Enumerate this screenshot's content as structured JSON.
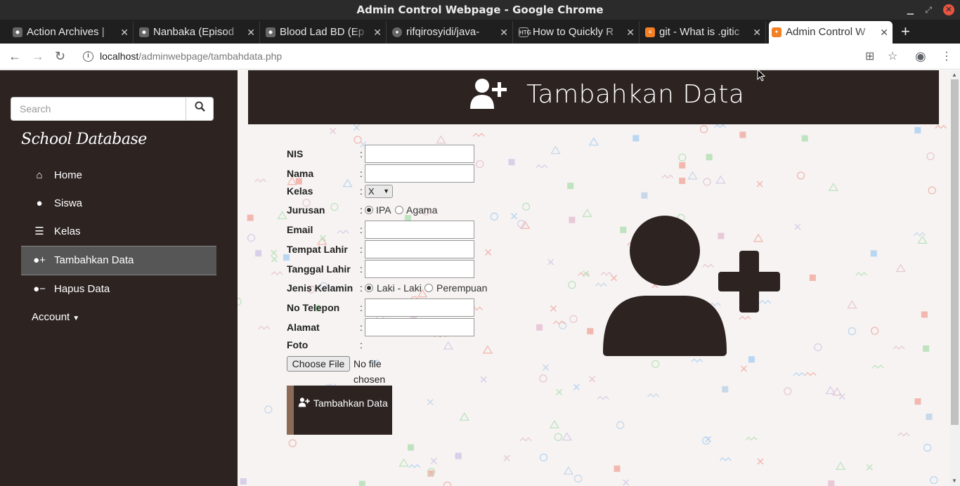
{
  "window": {
    "title": "Admin Control Webpage - Google Chrome"
  },
  "tabs": [
    {
      "label": "Action Archives |",
      "favicon": "cat-icon"
    },
    {
      "label": "Nanbaka (Episod",
      "favicon": "cat-icon"
    },
    {
      "label": "Blood Lad BD (Ep",
      "favicon": "cat-icon"
    },
    {
      "label": "rifqirosyidi/java-",
      "favicon": "github-icon"
    },
    {
      "label": "How to Quickly R",
      "favicon": "htg-icon"
    },
    {
      "label": "git - What is .gitic",
      "favicon": "stackoverflow-icon"
    },
    {
      "label": "Admin Control W",
      "favicon": "page-icon",
      "active": true
    }
  ],
  "address": {
    "host": "localhost",
    "path": "/adminwebpage/tambahdata.php"
  },
  "sidebar": {
    "search_placeholder": "Search",
    "brand": "School Database",
    "items": [
      {
        "label": "Home",
        "icon": "home-icon"
      },
      {
        "label": "Siswa",
        "icon": "user-icon"
      },
      {
        "label": "Kelas",
        "icon": "list-icon"
      },
      {
        "label": "Tambahkan Data",
        "icon": "user-plus-icon",
        "active": true
      },
      {
        "label": "Hapus Data",
        "icon": "user-minus-icon"
      }
    ],
    "account": "Account"
  },
  "header": {
    "title": "Tambahkan Data"
  },
  "form": {
    "nis": "NIS",
    "nama": "Nama",
    "kelas": "Kelas",
    "kelas_value": "X",
    "jurusan": "Jurusan",
    "jurusan_opt1": "IPA",
    "jurusan_opt2": "Agama",
    "email": "Email",
    "tempat_lahir": "Tempat Lahir",
    "tanggal_lahir": "Tanggal Lahir",
    "jenis_kelamin": "Jenis Kelamin",
    "jk_opt1": "Laki - Laki",
    "jk_opt2": "Perempuan",
    "no_telepon": "No Telepon",
    "alamat": "Alamat",
    "foto": "Foto",
    "colon": ":",
    "choose_file": "Choose File",
    "no_file": "No file chosen",
    "submit": "Tambahkan Data"
  },
  "colors": {
    "dark": "#2d2422",
    "accent": "#8c6a58",
    "active_menu": "#565656"
  }
}
